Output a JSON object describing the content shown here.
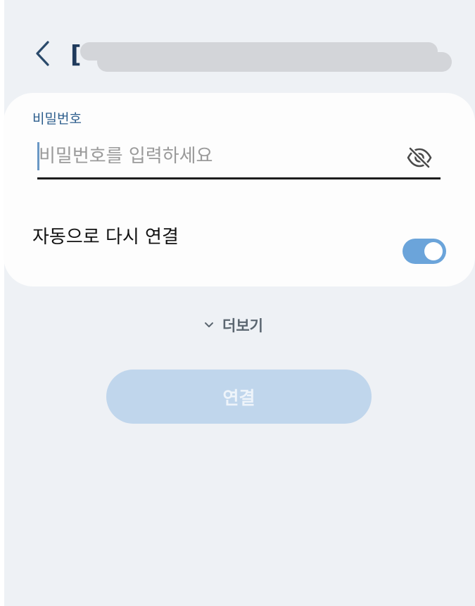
{
  "header": {
    "title_visible_prefix": "["
  },
  "password": {
    "label": "비밀번호",
    "placeholder": "비밀번호를 입력하세요",
    "value": ""
  },
  "auto_reconnect": {
    "label": "자동으로 다시 연결",
    "enabled": true
  },
  "more": {
    "label": "더보기"
  },
  "connect": {
    "label": "연결"
  },
  "icons": {
    "back": "chevron-left-icon",
    "visibility": "eye-slash-icon",
    "more": "chevron-down-icon"
  },
  "colors": {
    "background": "#eef1f5",
    "card": "#fdfdfd",
    "label_accent": "#2d5e8d",
    "toggle_on": "#6ba4da",
    "button_disabled": "#c0d6ec"
  }
}
